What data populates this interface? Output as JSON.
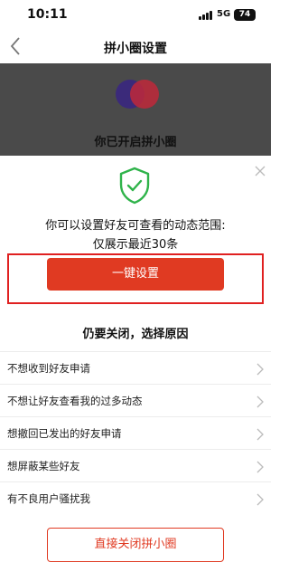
{
  "status_bar": {
    "time": "10:11",
    "network": "5G",
    "battery": "74"
  },
  "nav": {
    "title": "拼小圈设置"
  },
  "banner": {
    "text": "你已开启拼小圈"
  },
  "sheet": {
    "info_line1": "你可以设置好友可查看的动态范围:",
    "info_line2": "仅展示最近30条",
    "primary_button": "一键设置",
    "section_title": "仍要关闭，选择原因",
    "reasons": [
      "不想收到好友申请",
      "不想让好友查看我的过多动态",
      "想撤回已发出的好友申请",
      "想屏蔽某些好友",
      "有不良用户骚扰我"
    ],
    "close_button": "直接关闭拼小圈"
  },
  "colors": {
    "accent": "#e03a22",
    "shield": "#2fb34a",
    "banner": "#4a4a4a"
  }
}
